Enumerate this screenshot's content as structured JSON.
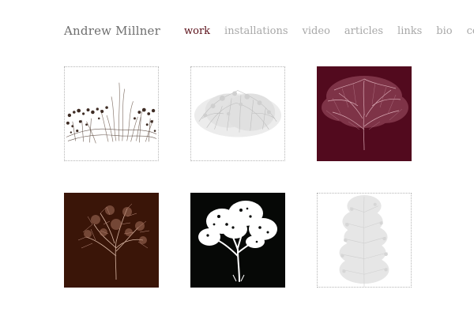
{
  "header": {
    "title": "Andrew Millner"
  },
  "nav": {
    "items": [
      {
        "label": "work",
        "active": true
      },
      {
        "label": "installations",
        "active": false
      },
      {
        "label": "video",
        "active": false
      },
      {
        "label": "articles",
        "active": false
      },
      {
        "label": "links",
        "active": false
      },
      {
        "label": "bio",
        "active": false
      },
      {
        "label": "contact",
        "active": false
      }
    ]
  },
  "gallery": {
    "thumbnails": [
      {
        "subject": "grass-drawing",
        "background": "#ffffff",
        "ink": "#4a3a32"
      },
      {
        "subject": "shrub-drawing",
        "background": "#ffffff",
        "ink": "#c4c4c4"
      },
      {
        "subject": "tree-drawing",
        "background": "#520a1e",
        "ink": "#d9a9b4"
      },
      {
        "subject": "tree-drawing",
        "background": "#3a1508",
        "ink": "#d8b6a4"
      },
      {
        "subject": "tree-drawing",
        "background": "#060806",
        "ink": "#ffffff"
      },
      {
        "subject": "tall-tree-drawing",
        "background": "#ffffff",
        "ink": "#e2e2e2"
      }
    ]
  },
  "colors": {
    "active_nav": "#5a0f18",
    "nav": "#a8a8a8",
    "title": "#6e6e6e",
    "thumb_border": "#b5b5b5"
  }
}
